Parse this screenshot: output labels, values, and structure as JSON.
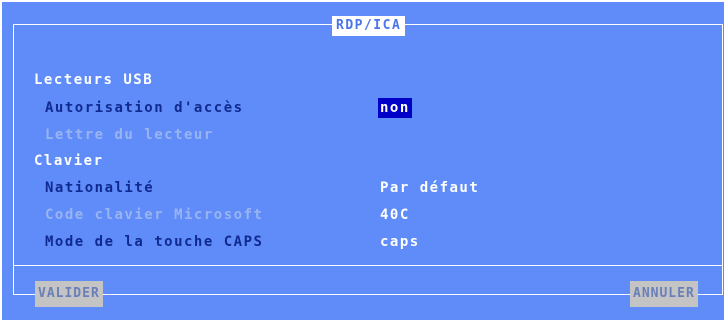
{
  "dialog": {
    "title": "RDP/ICA"
  },
  "usb": {
    "section_label": "Lecteurs USB",
    "access_label": "Autorisation d'accès",
    "access_value": "non",
    "drive_letter_label": "Lettre du lecteur"
  },
  "keyboard": {
    "section_label": "Clavier",
    "nationality_label": "Nationalité",
    "nationality_value": "Par défaut",
    "ms_code_label": "Code clavier Microsoft",
    "ms_code_value": "40C",
    "caps_mode_label": "Mode de la touche CAPS",
    "caps_mode_value": "caps"
  },
  "buttons": {
    "validate": "VALIDER",
    "cancel": "ANNULER"
  },
  "colors": {
    "background": "#5f8cf9",
    "highlight": "#0000c8",
    "button": "#c4c4c4"
  }
}
